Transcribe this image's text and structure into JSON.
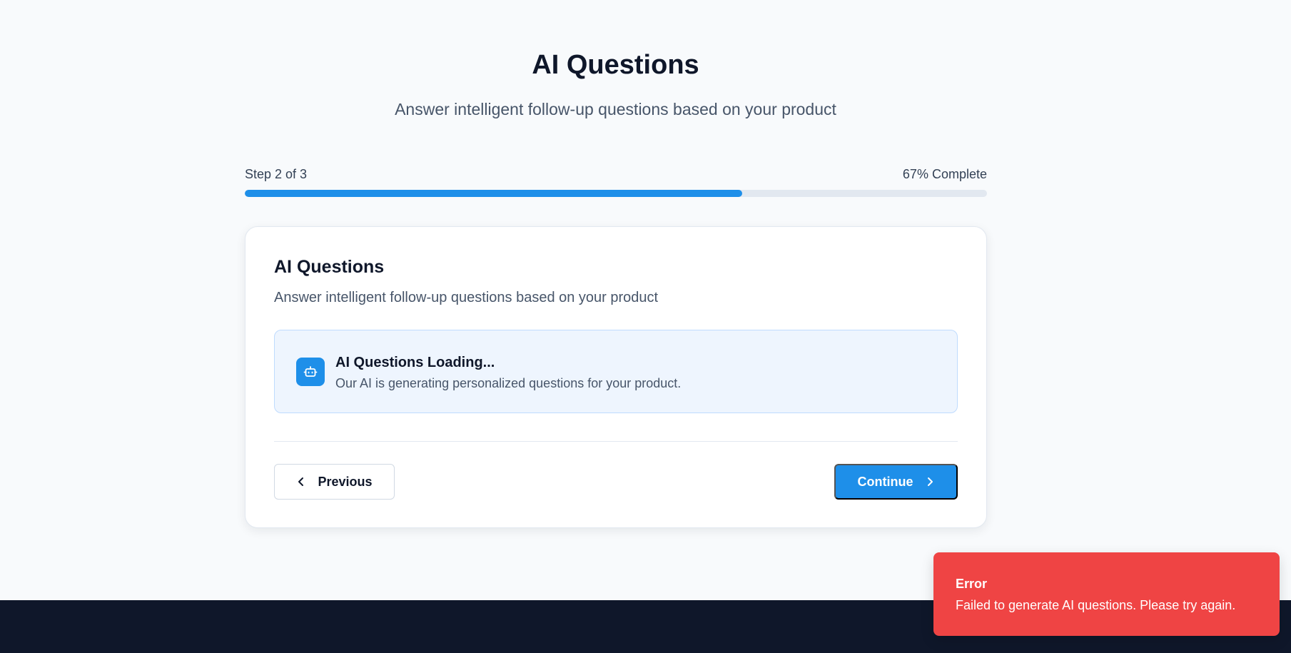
{
  "header": {
    "title": "AI Questions",
    "subtitle": "Answer intelligent follow-up questions based on your product"
  },
  "progress": {
    "step_label": "Step 2 of 3",
    "percent_label": "67% Complete",
    "fraction": 0.67
  },
  "card": {
    "title": "AI Questions",
    "subtitle": "Answer intelligent follow-up questions based on your product",
    "loading": {
      "icon": "bot-icon",
      "title": "AI Questions Loading...",
      "text": "Our AI is generating personalized questions for your product."
    },
    "previous_label": "Previous",
    "continue_label": "Continue"
  },
  "toast": {
    "title": "Error",
    "message": "Failed to generate AI questions. Please try again."
  },
  "colors": {
    "accent": "#1e8fe9",
    "error": "#ef4444",
    "footer": "#0f172a"
  }
}
